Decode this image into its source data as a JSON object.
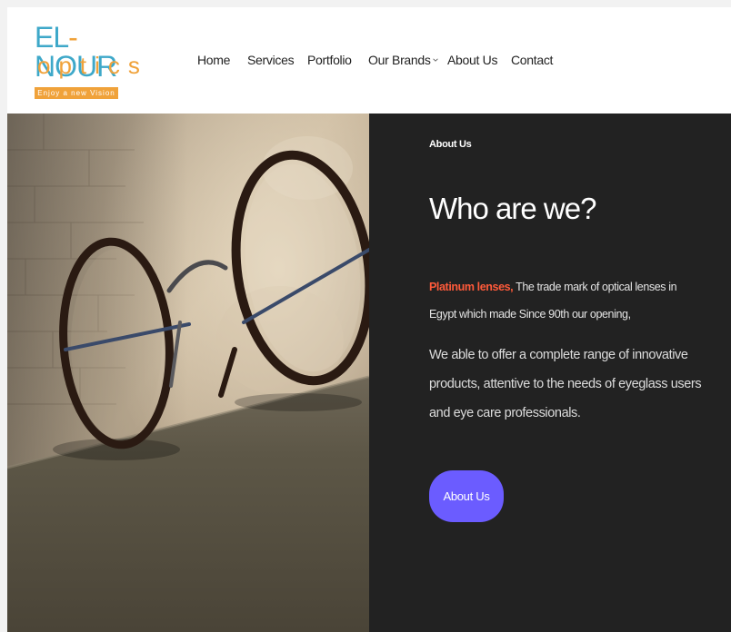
{
  "logo": {
    "line1_a": "EL",
    "line1_dash": "-",
    "line1_b": "NOUR",
    "line2": "optics",
    "tagline": "Enjoy a new Vision"
  },
  "nav": {
    "items": [
      {
        "label": "Home"
      },
      {
        "label": "Services"
      },
      {
        "label": "Portfolio"
      },
      {
        "label": "Our Brands",
        "has_dropdown": true
      },
      {
        "label": "About Us"
      },
      {
        "label": "Contact"
      }
    ]
  },
  "about": {
    "eyebrow": "About Us",
    "heading": "Who are we?",
    "highlight": "Platinum lenses,",
    "para1_rest": " The trade mark of optical lenses in Egypt which made Since 90th our opening,",
    "para2": "We able to offer a complete range of innovative products, attentive to the needs of eyeglass users and eye care professionals.",
    "button_label": "About Us"
  },
  "colors": {
    "panel_bg": "#222222",
    "accent_button": "#6b5cff",
    "highlight_text": "#ff5a3a",
    "logo_blue": "#3ea8c9",
    "logo_orange": "#f0a23a"
  },
  "hero_image": {
    "icon": "eyeglasses-photo"
  }
}
